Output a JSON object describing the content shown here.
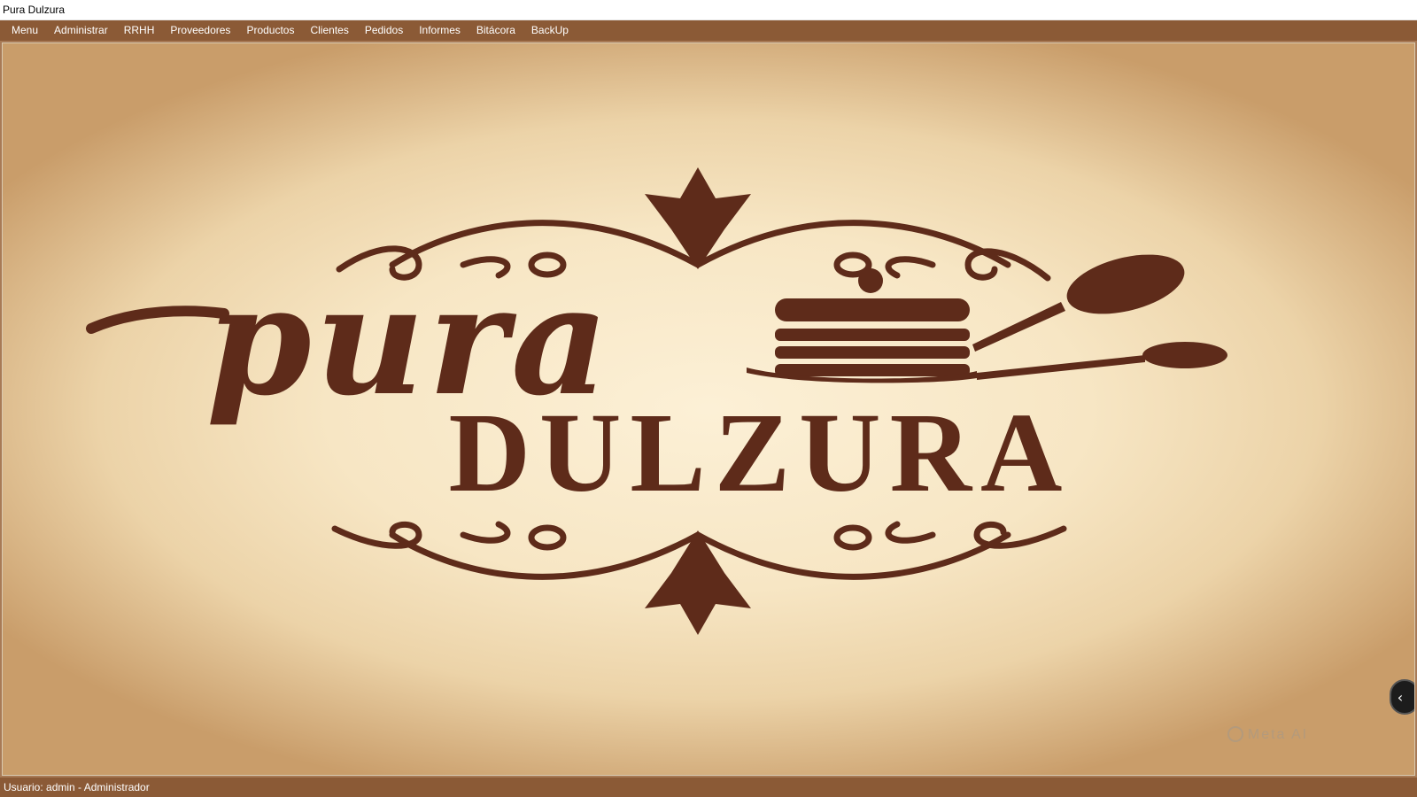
{
  "window": {
    "title": "Pura Dulzura"
  },
  "menubar": {
    "items": [
      {
        "label": "Menu"
      },
      {
        "label": "Administrar"
      },
      {
        "label": "RRHH"
      },
      {
        "label": "Proveedores"
      },
      {
        "label": "Productos"
      },
      {
        "label": "Clientes"
      },
      {
        "label": "Pedidos"
      },
      {
        "label": "Informes"
      },
      {
        "label": "Bitácora"
      },
      {
        "label": "BackUp"
      }
    ]
  },
  "logo": {
    "script_text": "pura",
    "main_text": "DULZURA",
    "watermark": "Meta AI"
  },
  "statusbar": {
    "text": "Usuario: admin - Administrador"
  },
  "colors": {
    "bar_brown": "#8b5a36",
    "logo_brown": "#5e2b1a",
    "parchment": "#f7e6c4"
  },
  "icons": {
    "scroll_handle": "chevron-left-icon"
  }
}
